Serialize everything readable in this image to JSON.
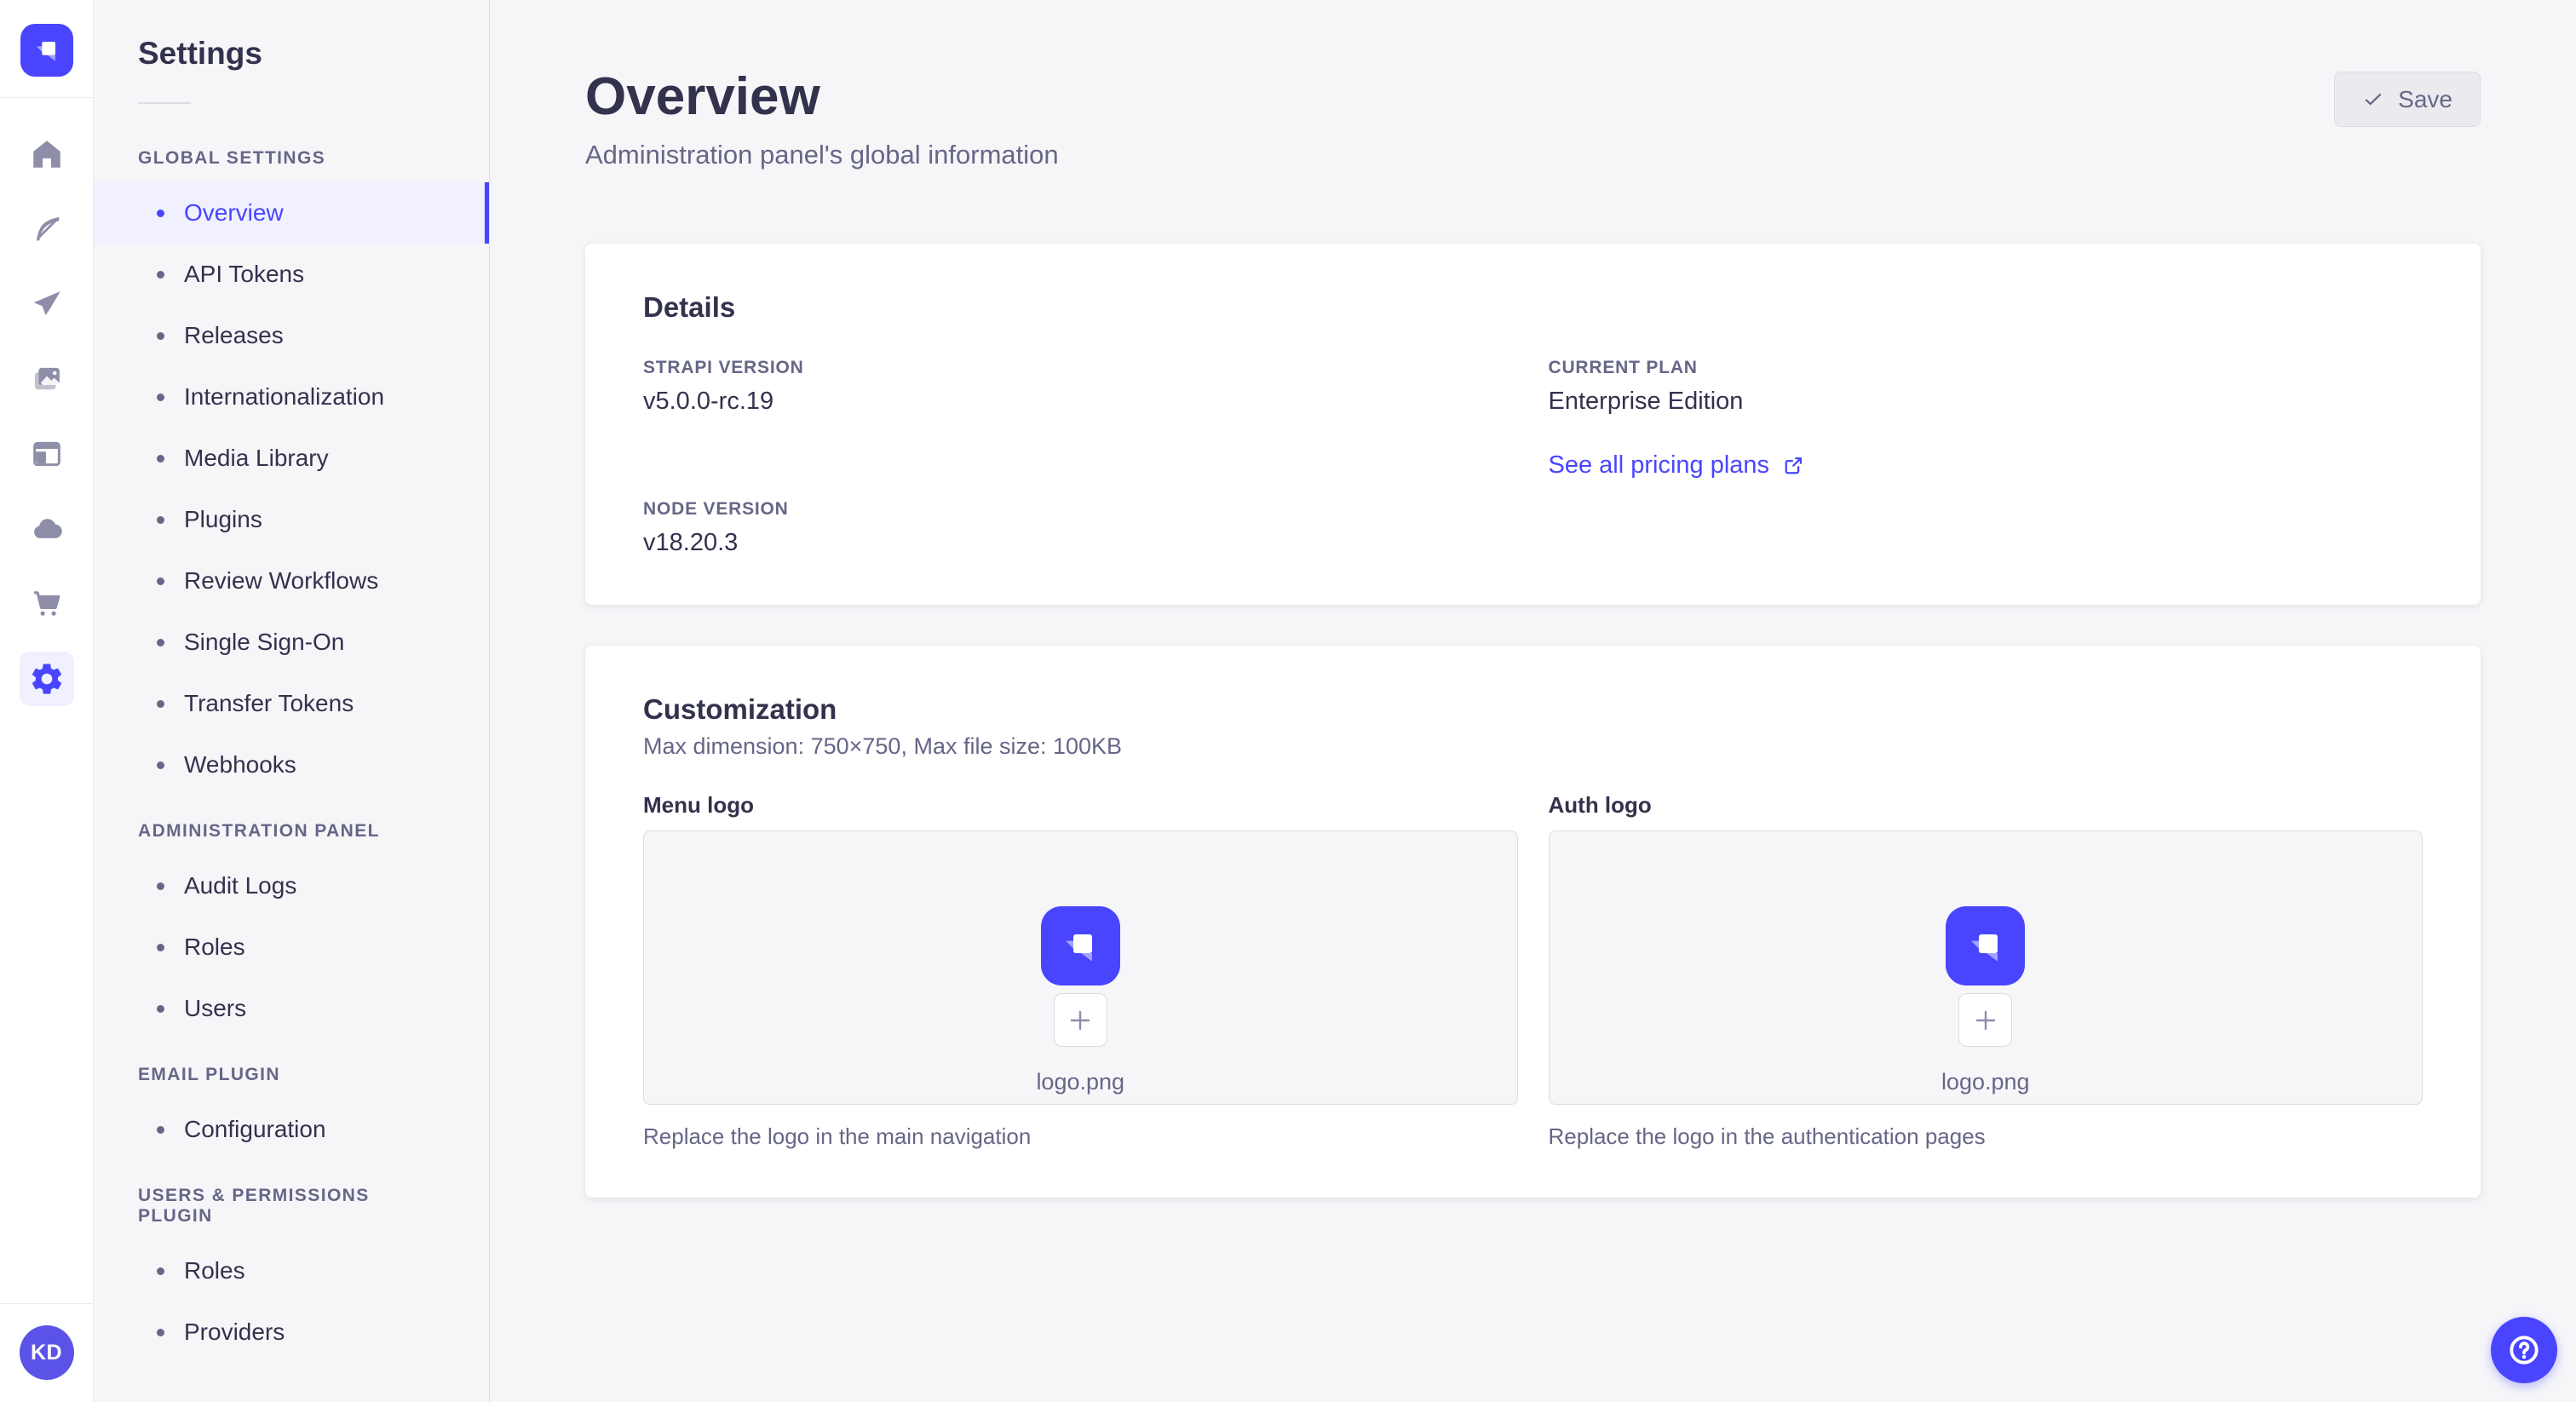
{
  "rail": {
    "avatar_initials": "KD"
  },
  "settings_nav": {
    "title": "Settings",
    "sections": [
      {
        "label": "GLOBAL SETTINGS",
        "items": [
          {
            "label": "Overview",
            "active": true
          },
          {
            "label": "API Tokens"
          },
          {
            "label": "Releases"
          },
          {
            "label": "Internationalization"
          },
          {
            "label": "Media Library"
          },
          {
            "label": "Plugins"
          },
          {
            "label": "Review Workflows"
          },
          {
            "label": "Single Sign-On"
          },
          {
            "label": "Transfer Tokens"
          },
          {
            "label": "Webhooks"
          }
        ]
      },
      {
        "label": "ADMINISTRATION PANEL",
        "items": [
          {
            "label": "Audit Logs"
          },
          {
            "label": "Roles"
          },
          {
            "label": "Users"
          }
        ]
      },
      {
        "label": "EMAIL PLUGIN",
        "items": [
          {
            "label": "Configuration"
          }
        ]
      },
      {
        "label": "USERS & PERMISSIONS PLUGIN",
        "items": [
          {
            "label": "Roles"
          },
          {
            "label": "Providers"
          }
        ]
      }
    ]
  },
  "header": {
    "title": "Overview",
    "subtitle": "Administration panel's global information",
    "save_label": "Save"
  },
  "details": {
    "title": "Details",
    "strapi_version_label": "STRAPI VERSION",
    "strapi_version": "v5.0.0-rc.19",
    "node_version_label": "NODE VERSION",
    "node_version": "v18.20.3",
    "current_plan_label": "CURRENT PLAN",
    "current_plan": "Enterprise Edition",
    "pricing_link": "See all pricing plans"
  },
  "customization": {
    "title": "Customization",
    "subtitle": "Max dimension: 750×750, Max file size: 100KB",
    "menu_logo_label": "Menu logo",
    "auth_logo_label": "Auth logo",
    "filename": "logo.png",
    "menu_caption": "Replace the logo in the main navigation",
    "auth_caption": "Replace the logo in the authentication pages"
  },
  "colors": {
    "primary": "#4945ff",
    "primary_light_bg": "#f0f0ff",
    "text_dark": "#32324d",
    "text_muted": "#666687",
    "avatar_bg": "#5b52e8",
    "page_bg": "#f6f6f9"
  },
  "icons": [
    "strapi-logo",
    "home-icon",
    "feather-icon",
    "send-icon",
    "media-icon",
    "layout-icon",
    "cloud-icon",
    "cart-icon",
    "gear-icon",
    "check-icon",
    "external-link-icon",
    "plus-icon",
    "question-icon"
  ]
}
